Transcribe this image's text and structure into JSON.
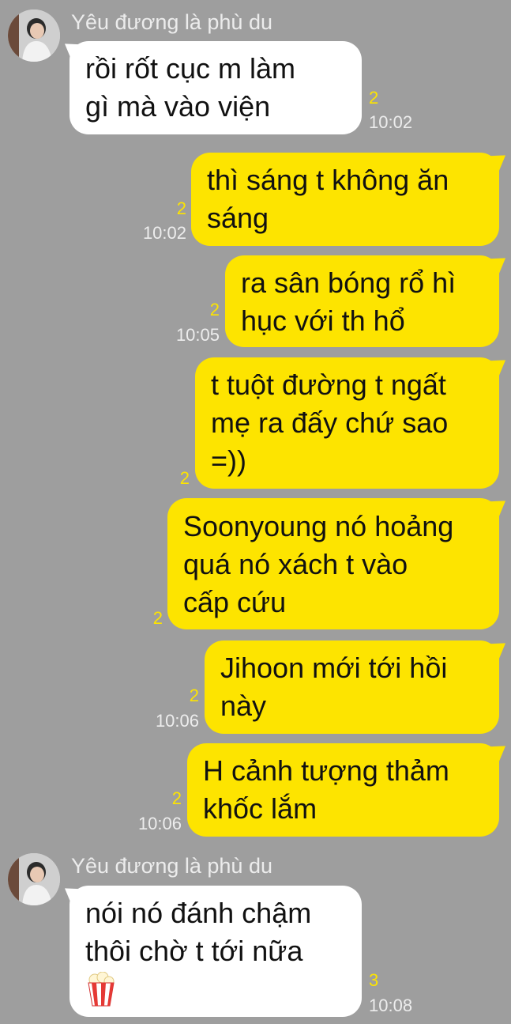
{
  "sender": "Yêu đương là phù du",
  "messages": [
    {
      "id": "m1",
      "direction": "incoming",
      "lines": [
        "rồi rốt cục m làm",
        "gì mà vào viện"
      ],
      "unread": "2",
      "time": "10:02"
    },
    {
      "id": "m2",
      "direction": "outgoing",
      "lines": [
        "thì sáng t không ăn",
        "sáng"
      ],
      "unread": "2",
      "time": "10:02"
    },
    {
      "id": "m3",
      "direction": "outgoing",
      "lines": [
        "ra sân bóng rổ hì",
        "hục với th hổ"
      ],
      "unread": "2",
      "time": "10:05"
    },
    {
      "id": "m4",
      "direction": "outgoing",
      "lines": [
        "t tuột đường t ngất",
        "mẹ ra đấy chứ sao",
        "=))"
      ],
      "unread": "2",
      "time": ""
    },
    {
      "id": "m5",
      "direction": "outgoing",
      "lines": [
        "Soonyoung nó hoảng",
        "quá nó xách t vào",
        "cấp cứu"
      ],
      "unread": "2",
      "time": ""
    },
    {
      "id": "m6",
      "direction": "outgoing",
      "lines": [
        "Jihoon mới tới hồi",
        "này"
      ],
      "unread": "2",
      "time": "10:06"
    },
    {
      "id": "m7",
      "direction": "outgoing",
      "lines": [
        "H cảnh tượng thảm",
        "khốc lắm"
      ],
      "unread": "2",
      "time": "10:06"
    },
    {
      "id": "m8",
      "direction": "incoming",
      "lines": [
        "nói nó đánh chậm",
        "thôi chờ t tới nữa",
        "🍿"
      ],
      "unread": "3",
      "time": "10:08"
    }
  ],
  "colors": {
    "background": "#9e9e9e",
    "outgoing_bubble": "#fde400",
    "incoming_bubble": "#ffffff",
    "unread_count": "#fde400"
  },
  "icons": {
    "avatar": "profile-photo",
    "emoji": "popcorn"
  }
}
